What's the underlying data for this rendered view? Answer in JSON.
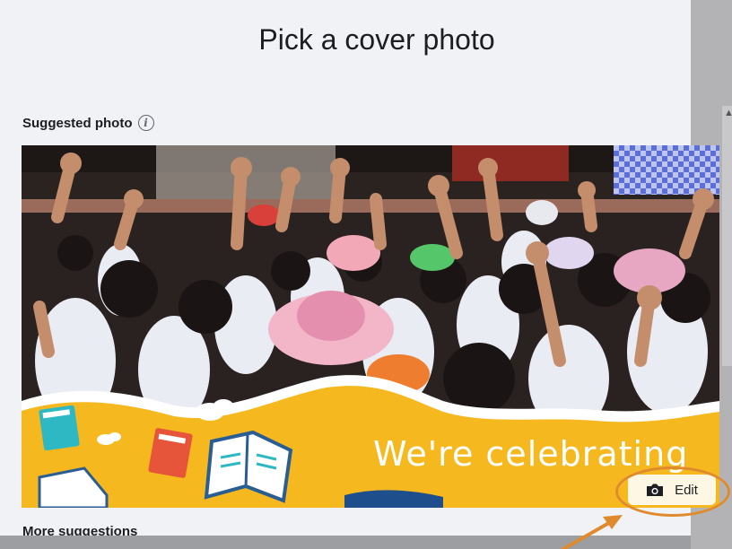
{
  "dialog": {
    "title": "Pick a cover photo",
    "suggested_heading": "Suggested photo",
    "more_suggestions": "More suggestions"
  },
  "cover_photo": {
    "banner_text": "We're celebrating",
    "edit_label": "Edit"
  },
  "icons": {
    "info": "info-icon",
    "camera": "camera-icon"
  },
  "colors": {
    "dialog_bg": "#f0f2f5",
    "banner_yellow": "#f5b81e",
    "highlight": "#e08a2e"
  }
}
